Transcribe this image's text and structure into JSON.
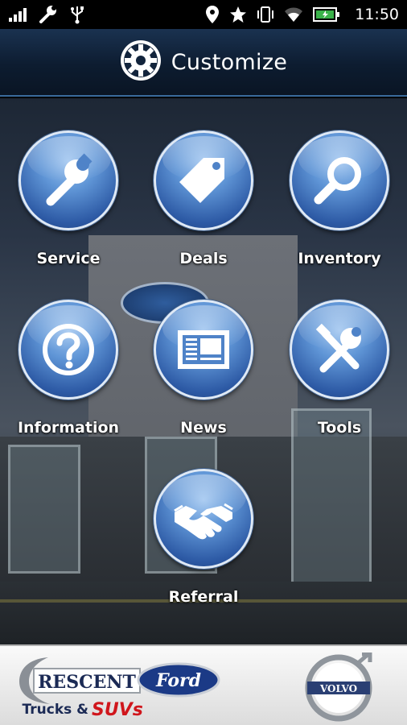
{
  "status_bar": {
    "time": "11:50",
    "icons": [
      "signal-icon",
      "wrench-icon",
      "usb-icon",
      "location-icon",
      "star-icon",
      "vibrate-icon",
      "wifi-icon",
      "battery-icon"
    ]
  },
  "header": {
    "title": "Customize",
    "icon": "gear-icon"
  },
  "menu": [
    {
      "label": "Service",
      "icon": "wrench-icon"
    },
    {
      "label": "Deals",
      "icon": "tag-icon"
    },
    {
      "label": "Inventory",
      "icon": "magnifier-icon"
    },
    {
      "label": "Information",
      "icon": "question-icon"
    },
    {
      "label": "News",
      "icon": "newspaper-icon"
    },
    {
      "label": "Tools",
      "icon": "tools-icon"
    },
    {
      "label": "Referral",
      "icon": "handshake-icon"
    }
  ],
  "footer": {
    "dealer_logo": {
      "line1": "RESCENT",
      "brand": "Ford",
      "line2": "Trucks &",
      "line3": "SUVs"
    },
    "partner_logo": {
      "text": "VOLVO"
    }
  },
  "colors": {
    "accent": "#2d5aa5",
    "header_bg": "#0d1c30",
    "footer_bg": "#eeeeee"
  }
}
